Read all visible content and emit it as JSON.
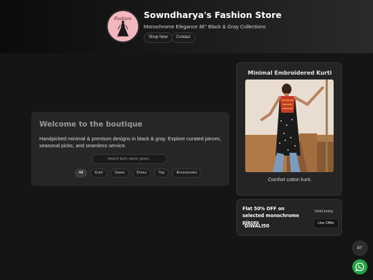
{
  "header": {
    "store_name": "Sowndharya's Fashion Store",
    "tagline": "Monochrome Elegance â€” Black & Gray Collections",
    "buttons": [
      "Shop Now",
      "Contact"
    ],
    "logo_icon": "dress-logo-icon"
  },
  "welcome": {
    "title": "Welcome to the boutique",
    "description": "Handpicked minimal & premium designs in black & gray. Explore curated pieces, seasonal picks, and seamless service.",
    "search_placeholder": "Search kurti, saree, gown...",
    "chips": [
      "All",
      "Kurti",
      "Saree",
      "Dress",
      "Top",
      "Accessories"
    ],
    "active_chip": "All"
  },
  "product": {
    "title": "Minimal Embroidered Kurti",
    "caption": "Comfort cotton kurti."
  },
  "offer": {
    "text": "Flat 50% OFF on selected monochrome pieces",
    "code": "DIWALI50",
    "validity": "Valid today",
    "button": "Use Offer"
  },
  "fabs": {
    "top_label": "â†‘",
    "whatsapp_icon": "whatsapp-icon"
  },
  "colors": {
    "background": "#151515",
    "card": "#262626",
    "logo_bg": "#f2b8bd",
    "whatsapp": "#25a244"
  }
}
